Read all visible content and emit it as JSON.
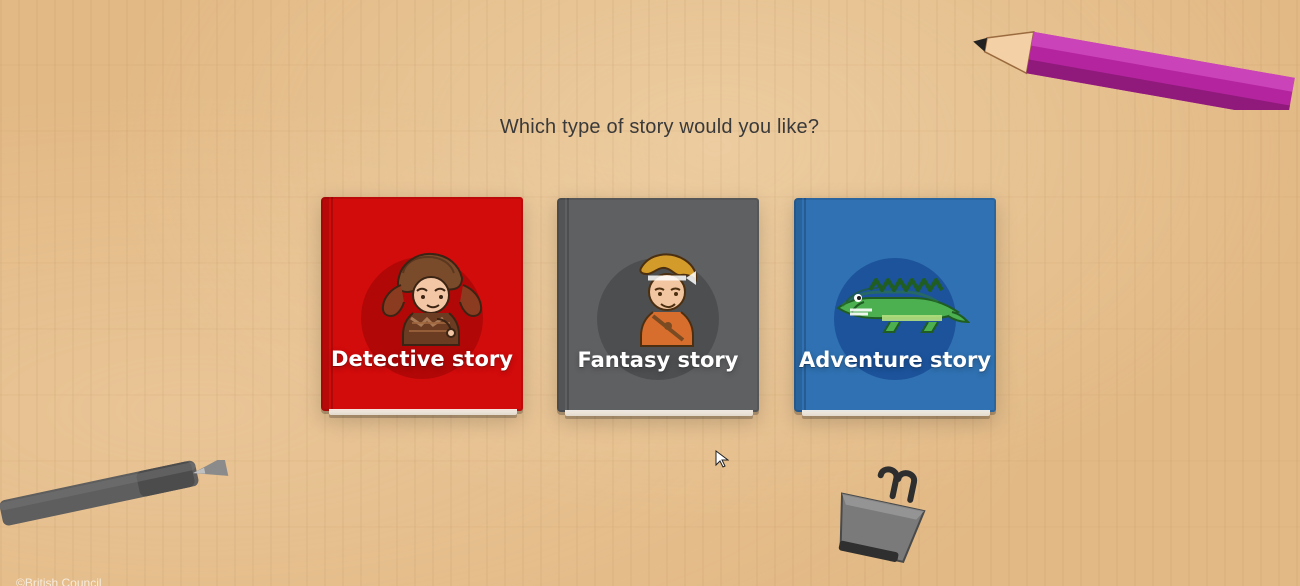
{
  "page": {
    "question": "Which type of story would you like?",
    "copyright": "©British Council"
  },
  "books": [
    {
      "key": "detective",
      "title": "Detective story",
      "icon": "detective-girl-icon",
      "color": "#D20B0B"
    },
    {
      "key": "fantasy",
      "title": "Fantasy story",
      "icon": "fantasy-boy-icon",
      "color": "#5F6062"
    },
    {
      "key": "adventure",
      "title": "Adventure story",
      "icon": "crocodile-icon",
      "color": "#2F71B2"
    }
  ],
  "decor": {
    "pencil_icon": "pencil-icon",
    "pen_icon": "pen-icon",
    "binder_clip_icon": "binder-clip-icon",
    "cursor_icon": "mouse-cursor-icon",
    "desk_color": "#E2B985",
    "pencil_color": "#B5249F"
  }
}
